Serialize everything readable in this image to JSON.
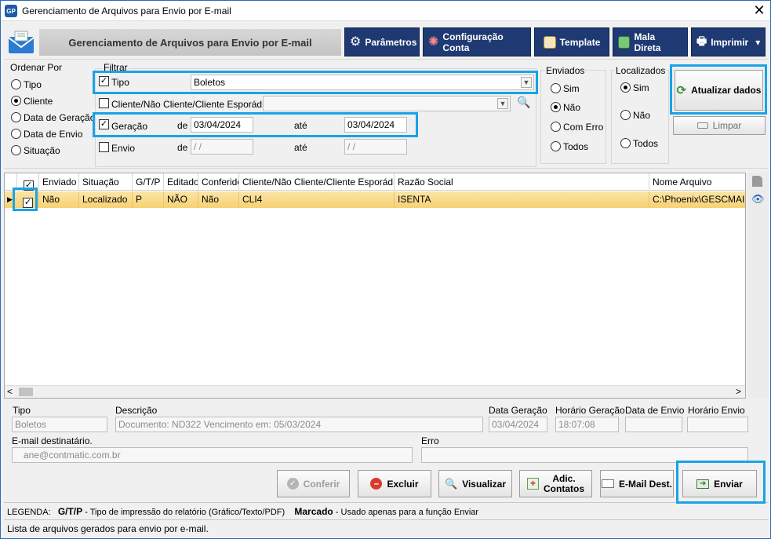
{
  "window": {
    "logo_text": "GP",
    "title": "Gerenciamento de Arquivos para Envio por E-mail",
    "close_glyph": "✕"
  },
  "header": {
    "banner": "Gerenciamento de Arquivos para Envio por E-mail",
    "toolbar": {
      "parametros": "Parâmetros",
      "configuracao": "Configuração Conta",
      "template": "Template",
      "mala_direta": "Mala Direta",
      "imprimir": "Imprimir",
      "imprimir_arrow": "▾"
    }
  },
  "filters": {
    "ordenar_title": "Ordenar Por",
    "ordenar_options": [
      "Tipo",
      "Cliente",
      "Data de Geração",
      "Data de Envio",
      "Situação"
    ],
    "ordenar_selected": "Cliente",
    "filtrar_title": "Filtrar",
    "tipo_label": "Tipo",
    "tipo_checked": true,
    "tipo_value": "Boletos",
    "cliente_label": "Cliente/Não Cliente/Cliente Esporádico",
    "cliente_checked": false,
    "cliente_value": "",
    "geracao_label": "Geração",
    "geracao_checked": true,
    "geracao_de": "03/04/2024",
    "geracao_ate": "03/04/2024",
    "envio_label": "Envio",
    "envio_checked": false,
    "envio_de": " / /",
    "envio_ate": " / /",
    "de_label": "de",
    "ate_label": "até",
    "enviados_title": "Enviados",
    "enviados_options": [
      "Sim",
      "Não",
      "Com Erro",
      "Todos"
    ],
    "enviados_selected": "Não",
    "localizados_title": "Localizados",
    "localizados_options": [
      "Sim",
      "Não",
      "Todos"
    ],
    "localizados_selected": "Sim",
    "atualizar_label": "Atualizar dados",
    "limpar_label": "Limpar"
  },
  "grid": {
    "columns": [
      "Enviado",
      "Situação",
      "G/T/P",
      "Editado",
      "Conferido",
      "Cliente/Não Cliente/Cliente Esporádico",
      "Razão Social",
      "Nome Arquivo"
    ],
    "rows": [
      {
        "checked": true,
        "enviado": "Não",
        "situacao": "Localizado",
        "gtp": "P",
        "editado": "NÃO",
        "conferido": "Não",
        "cliente": "CLI4",
        "razao": "ISENTA",
        "arquivo": "C:\\Phoenix\\GESCMAIL\\C"
      }
    ],
    "row_pointer": "▶",
    "scroll_left": "<",
    "scroll_right": ">"
  },
  "details": {
    "tipo_label": "Tipo",
    "tipo_value": "Boletos",
    "descricao_label": "Descrição",
    "descricao_value": "Documento: ND322 Vencimento em: 05/03/2024",
    "data_geracao_label": "Data Geração",
    "data_geracao_value": "03/04/2024",
    "horario_geracao_label": "Horário Geração",
    "horario_geracao_value": "18:07:08",
    "data_envio_label": "Data de Envio",
    "data_envio_value": "",
    "horario_envio_label": "Horário Envio",
    "horario_envio_value": "",
    "email_label": "E-mail destinatário.",
    "email_value": "ane@contmatic.com.br",
    "erro_label": "Erro",
    "erro_value": ""
  },
  "actions": {
    "conferir": "Conferir",
    "excluir": "Excluir",
    "visualizar": "Visualizar",
    "adic_contatos_1": "Adic.",
    "adic_contatos_2": "Contatos",
    "email_dest": "E-Mail Dest.",
    "enviar": "Enviar"
  },
  "legend": {
    "prefix": "LEGENDA:",
    "gtp_key": "G/T/P",
    "gtp_text": "- Tipo de impressão do relatório (Gráfico/Texto/PDF)",
    "marcado_key": "Marcado",
    "marcado_text": "- Usado apenas para a função Enviar"
  },
  "status_bar": "Lista de arquivos gerados para envio por e-mail."
}
